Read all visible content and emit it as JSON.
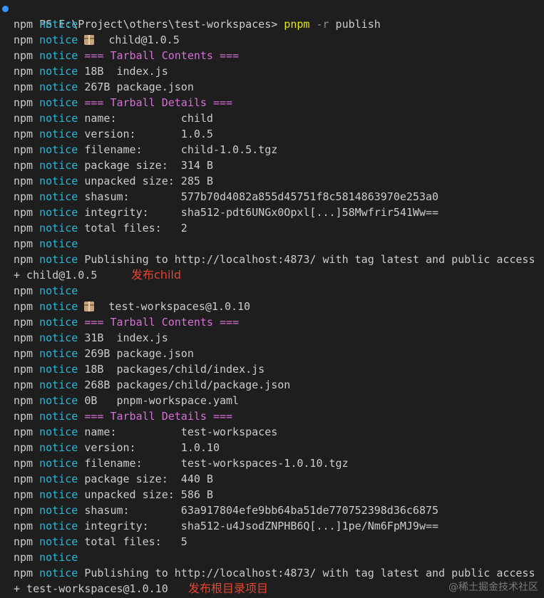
{
  "prompt": {
    "ps": "PS E:\\Project\\others\\test-workspaces> ",
    "command": "pnpm",
    "flag": "-r",
    "arg": "publish"
  },
  "npm_label": "npm",
  "notice_label": "notice",
  "lines": [
    {
      "text": ""
    },
    {
      "text": "child@1.0.5",
      "icon": "package-icon"
    },
    {
      "text": "=== Tarball Contents ===",
      "magenta": true
    },
    {
      "text": "18B  index.js"
    },
    {
      "text": "267B package.json"
    },
    {
      "text": "=== Tarball Details ===",
      "magenta": true
    },
    {
      "text": "name:          child"
    },
    {
      "text": "version:       1.0.5"
    },
    {
      "text": "filename:      child-1.0.5.tgz"
    },
    {
      "text": "package size:  314 B"
    },
    {
      "text": "unpacked size: 285 B"
    },
    {
      "text": "shasum:        577b70d4082a855d45751f8c5814863970e253a0"
    },
    {
      "text": "integrity:     sha512-pdt6UNGx0Opxl[...]58Mwfrir541Ww=="
    },
    {
      "text": "total files:   2"
    },
    {
      "text": ""
    },
    {
      "text": "Publishing to http://localhost:4873/ with tag latest and public access"
    },
    {
      "plain": "+ child@1.0.5",
      "annotation": "发布child"
    },
    {
      "text": ""
    },
    {
      "text": "test-workspaces@1.0.10",
      "icon": "package-icon"
    },
    {
      "text": "=== Tarball Contents ===",
      "magenta": true
    },
    {
      "text": "31B  index.js"
    },
    {
      "text": "269B package.json"
    },
    {
      "text": "18B  packages/child/index.js"
    },
    {
      "text": "268B packages/child/package.json"
    },
    {
      "text": "0B   pnpm-workspace.yaml"
    },
    {
      "text": "=== Tarball Details ===",
      "magenta": true
    },
    {
      "text": "name:          test-workspaces"
    },
    {
      "text": "version:       1.0.10"
    },
    {
      "text": "filename:      test-workspaces-1.0.10.tgz"
    },
    {
      "text": "package size:  440 B"
    },
    {
      "text": "unpacked size: 586 B"
    },
    {
      "text": "shasum:        63a917804efe9bb64ba51de770752398d36c6875"
    },
    {
      "text": "integrity:     sha512-u4JsodZNPHB6Q[...]1pe/Nm6FpMJ9w=="
    },
    {
      "text": "total files:   5"
    },
    {
      "text": ""
    },
    {
      "text": "Publishing to http://localhost:4873/ with tag latest and public access"
    },
    {
      "plain": "+ test-workspaces@1.0.10",
      "annotation": "发布根目录项目"
    }
  ],
  "watermark": "@稀土掘金技术社区",
  "colors": {
    "background": "#1e1e1e",
    "notice": "#29b8db",
    "magenta": "#d670d6",
    "command": "#e5e510",
    "annotation": "#e6442e"
  }
}
